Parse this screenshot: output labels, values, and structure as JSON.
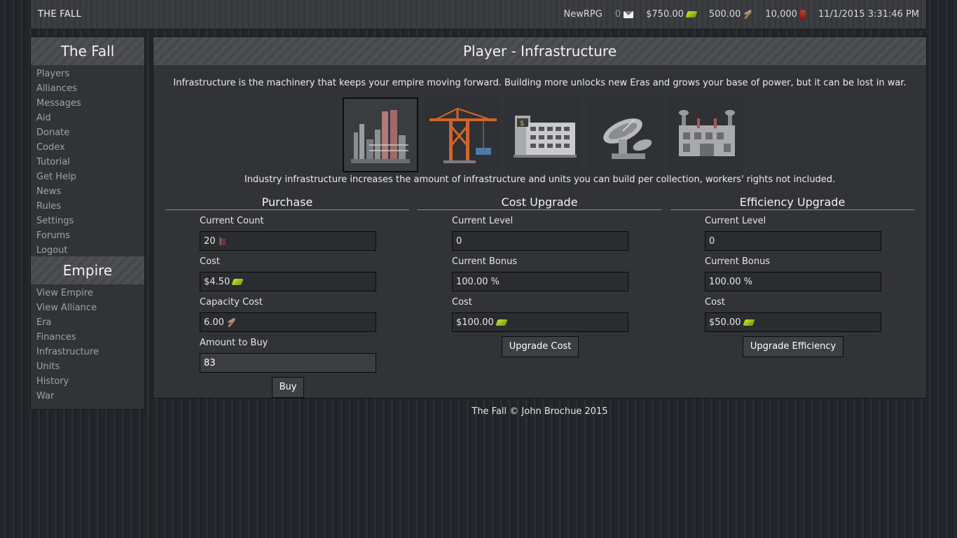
{
  "topbar": {
    "brand": "THE FALL",
    "player": "NewRPG",
    "messages": "0",
    "money": "$750.00",
    "capacity": "500.00",
    "military": "10,000",
    "datetime": "11/1/2015 3:31:46 PM"
  },
  "sidebar": {
    "header1": "The Fall",
    "links1": [
      "Players",
      "Alliances",
      "Messages",
      "Aid",
      "Donate",
      "Codex",
      "Tutorial",
      "Get Help",
      "News",
      "Rules",
      "Settings",
      "Forums",
      "Logout"
    ],
    "header2": "Empire",
    "links2": [
      "View Empire",
      "View Alliance",
      "Era",
      "Finances",
      "Infrastructure",
      "Units",
      "History",
      "War"
    ]
  },
  "main": {
    "title": "Player - Infrastructure",
    "intro": "Infrastructure is the machinery that keeps your empire moving forward. Building more unlocks new Eras and grows your base of power, but it can be lost in war.",
    "tiles": [
      "industry-tile",
      "port-crane-tile",
      "office-tile",
      "satellite-dish-tile",
      "power-plant-tile"
    ],
    "selected_description": "Industry infrastructure increases the amount of infrastructure and units you can build per collection, workers' rights not included.",
    "purchase": {
      "title": "Purchase",
      "count_label": "Current Count",
      "count_value": "20",
      "cost_label": "Cost",
      "cost_value": "$4.50",
      "capacity_label": "Capacity Cost",
      "capacity_value": "6.00",
      "amount_label": "Amount to Buy",
      "amount_value": "83",
      "button": "Buy"
    },
    "cost_upgrade": {
      "title": "Cost Upgrade",
      "level_label": "Current Level",
      "level_value": "0",
      "bonus_label": "Current Bonus",
      "bonus_value": "100.00 %",
      "cost_label": "Cost",
      "cost_value": "$100.00",
      "button": "Upgrade Cost"
    },
    "efficiency_upgrade": {
      "title": "Efficiency Upgrade",
      "level_label": "Current Level",
      "level_value": "0",
      "bonus_label": "Current Bonus",
      "bonus_value": "100.00 %",
      "cost_label": "Cost",
      "cost_value": "$50.00",
      "button": "Upgrade Efficiency"
    }
  },
  "footer": "The Fall © John Brochue 2015",
  "colors": {
    "background": "#24272b",
    "panel": "#313336",
    "header": "#4a4c50",
    "link": "#9ea3a8",
    "money_icon": "#9cc41e"
  }
}
